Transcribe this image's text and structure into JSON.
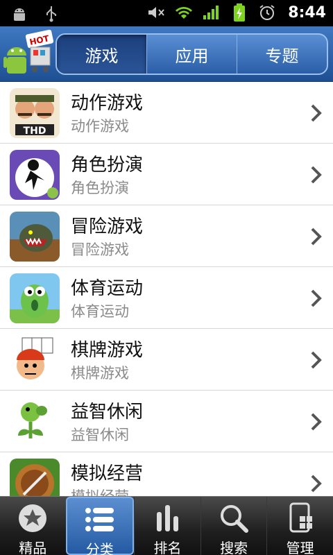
{
  "status_bar": {
    "time": "8:44",
    "icons": [
      "android-icon",
      "usb-icon",
      "mute-icon",
      "wifi-icon",
      "signal-icon",
      "battery-charging-icon",
      "alarm-icon"
    ]
  },
  "header": {
    "logo": "hot-android-cart-logo",
    "logo_badge": "HOT",
    "tabs": [
      {
        "label": "游戏",
        "active": true
      },
      {
        "label": "应用",
        "active": false
      },
      {
        "label": "专题",
        "active": false
      }
    ]
  },
  "categories": [
    {
      "title": "动作游戏",
      "subtitle": "动作游戏",
      "icon": "action-game-icon",
      "icon_text": "THD"
    },
    {
      "title": "角色扮演",
      "subtitle": "角色扮演",
      "icon": "role-play-icon"
    },
    {
      "title": "冒险游戏",
      "subtitle": "冒险游戏",
      "icon": "adventure-game-icon"
    },
    {
      "title": "体育运动",
      "subtitle": "体育运动",
      "icon": "sports-icon"
    },
    {
      "title": "棋牌游戏",
      "subtitle": "棋牌游戏",
      "icon": "card-game-icon"
    },
    {
      "title": "益智休闲",
      "subtitle": "益智休闲",
      "icon": "puzzle-casual-icon"
    },
    {
      "title": "模拟经营",
      "subtitle": "模拟经营",
      "icon": "simulation-icon"
    }
  ],
  "bottom_nav": [
    {
      "label": "精品",
      "icon": "star-icon",
      "active": false
    },
    {
      "label": "分类",
      "icon": "list-icon",
      "active": true
    },
    {
      "label": "排名",
      "icon": "ranking-bars-icon",
      "active": false
    },
    {
      "label": "搜索",
      "icon": "search-icon",
      "active": false
    },
    {
      "label": "管理",
      "icon": "manage-icon",
      "active": false
    }
  ],
  "colors": {
    "header_blue": "#2a5fa8",
    "active_tab": "#1c3f7c",
    "bottom_bar": "#1f1f1f",
    "status_green": "#7ed321"
  }
}
